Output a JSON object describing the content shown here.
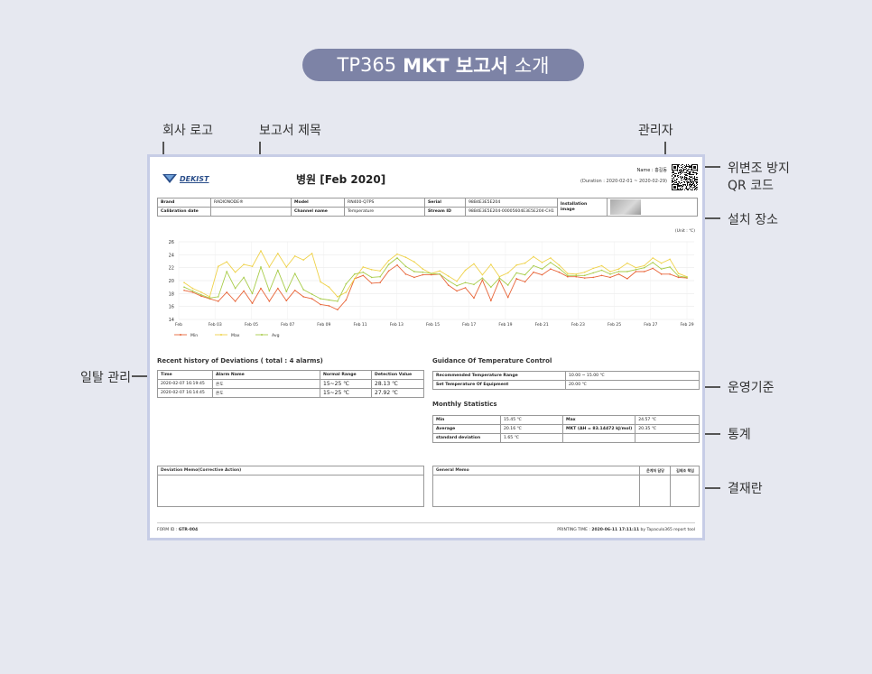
{
  "header": {
    "part1": "TP365",
    "part2": "MKT 보고서",
    "part3": "소개"
  },
  "annotations": {
    "logo": "회사 로고",
    "report_title": "보고서 제목",
    "manager": "관리자",
    "qr_line1": "위변조 방지",
    "qr_line2": "QR 코드",
    "install": "설치 장소",
    "daily": "일탈 관리",
    "operation": "운영기준",
    "stats": "통계",
    "approval": "결재란"
  },
  "report": {
    "logo_text": "DEKIST",
    "title": "병원 [Feb 2020]",
    "name": "Name : 홍길동",
    "duration": "(Duration : 2020-02-01 ~ 2020-02-29)",
    "unit": "(Unit : ℃)",
    "info": {
      "brand_l": "Brand",
      "brand_v": "RADIONODE®",
      "model_l": "Model",
      "model_v": "RN400-Q7PS",
      "serial_l": "Serial",
      "serial_v": "98B4E3E5E204",
      "install_l1": "Installation",
      "install_l2": "image",
      "calib_l": "Calibration date",
      "calib_v": "",
      "channel_l": "Channel name",
      "channel_v": "Temperature",
      "stream_l": "Stream ID",
      "stream_v": "98B4E3E5E204-00005604E3E5E204-CH1"
    },
    "deviation": {
      "title": "Recent history of Deviations ( total : 4 alarms)",
      "headers": [
        "Time",
        "Alarm Name",
        "Normal Range",
        "Detection Value"
      ],
      "rows": [
        [
          "2020-02-07 16:19:45",
          "온도",
          "15~25 ℃",
          "28.13 ℃"
        ],
        [
          "2020-02-07 16:14:45",
          "온도",
          "15~25 ℃",
          "27.92 ℃"
        ]
      ]
    },
    "guidance": {
      "title": "Guidance Of Temperature Control",
      "rows": [
        [
          "Recommended Temperature Range",
          "10.00 ~ 15.00 ℃"
        ],
        [
          "Set Temperature Of Equipment",
          "20.00 ℃"
        ]
      ]
    },
    "stats": {
      "title": "Monthly Statistics",
      "rows": [
        [
          "Min",
          "15.45 ℃",
          "Max",
          "24.57 ℃"
        ],
        [
          "Average",
          "20.16 ℃",
          "MKT (ΔH = 83.14472 kJ/mol)",
          "20.35 ℃"
        ],
        [
          "standard deviation",
          "1.65 ℃",
          "",
          ""
        ]
      ]
    },
    "memo_dev": "Deviation Memo(Corrective Action)",
    "memo_gen": "General Memo",
    "memo_sign1": "운계처 담당",
    "memo_sign2": "김제조 책임",
    "footer_form_label": "FORM ID : ",
    "footer_form_id": "GTR-004",
    "footer_print_label": "PRINTING TIME : ",
    "footer_print_time": "2020-06-11 17:11:11",
    "footer_print_tail": " by TapacuIo365 report tool"
  },
  "chart_data": {
    "type": "line",
    "ylim": [
      14,
      26
    ],
    "yticks": [
      14,
      16,
      18,
      20,
      22,
      24,
      26
    ],
    "xticks": [
      "Feb",
      "Feb 03",
      "Feb 05",
      "Feb 07",
      "Feb 09",
      "Feb 11",
      "Feb 13",
      "Feb 15",
      "Feb 17",
      "Feb 19",
      "Feb 21",
      "Feb 23",
      "Feb 25",
      "Feb 27",
      "Feb 29"
    ],
    "colors": {
      "Min": "#e8663a",
      "Max": "#efd24a",
      "Avg": "#a8cc4a"
    },
    "series": [
      {
        "name": "Min",
        "values": [
          18.5,
          18.2,
          17.6,
          17.2,
          16.8,
          18.2,
          16.8,
          18.4,
          16.5,
          18.8,
          16.8,
          18.8,
          16.9,
          18.5,
          17.5,
          17.2,
          16.3,
          16.1,
          15.5,
          17.0,
          20.3,
          20.8,
          19.6,
          19.7,
          21.5,
          22.4,
          21.0,
          20.5,
          20.9,
          20.9,
          21.0,
          19.3,
          18.4,
          18.9,
          17.3,
          20.1,
          16.9,
          20.1,
          17.4,
          20.3,
          19.8,
          21.3,
          20.9,
          21.8,
          21.3,
          20.6,
          20.6,
          20.4,
          20.5,
          20.8,
          20.5,
          21.0,
          20.3,
          21.4,
          21.4,
          21.9,
          21.0,
          21.0,
          20.5,
          20.4
        ]
      },
      {
        "name": "Max",
        "values": [
          19.7,
          18.8,
          18.2,
          17.5,
          22.2,
          22.9,
          21.3,
          22.5,
          22.2,
          24.6,
          22.1,
          24.2,
          22.1,
          23.8,
          23.2,
          24.2,
          19.8,
          19.0,
          17.5,
          18.2,
          20.3,
          22.1,
          21.7,
          21.5,
          23.1,
          24.1,
          23.6,
          22.9,
          21.8,
          21.1,
          21.5,
          20.7,
          19.9,
          21.6,
          22.6,
          20.9,
          22.5,
          20.6,
          21.2,
          22.4,
          22.7,
          23.7,
          22.8,
          23.5,
          22.4,
          21.1,
          21.0,
          21.3,
          21.9,
          22.3,
          21.4,
          21.8,
          22.7,
          22.0,
          22.3,
          23.5,
          22.7,
          23.3,
          21.1,
          20.6
        ]
      },
      {
        "name": "Avg",
        "values": [
          19.0,
          18.4,
          17.8,
          17.3,
          17.5,
          21.4,
          18.8,
          20.5,
          18.0,
          22.1,
          18.4,
          21.6,
          18.3,
          21.1,
          18.6,
          17.9,
          17.2,
          17.0,
          16.8,
          19.5,
          21.0,
          21.3,
          20.5,
          20.6,
          22.5,
          23.5,
          22.2,
          21.4,
          21.3,
          21.1,
          21.0,
          20.0,
          19.2,
          19.7,
          19.4,
          20.4,
          19.0,
          20.4,
          19.3,
          21.2,
          20.9,
          22.3,
          21.8,
          22.8,
          21.9,
          20.8,
          20.8,
          20.8,
          21.2,
          21.6,
          21.0,
          21.4,
          21.4,
          21.7,
          22.0,
          22.8,
          21.8,
          22.1,
          20.7,
          20.5
        ]
      }
    ]
  }
}
